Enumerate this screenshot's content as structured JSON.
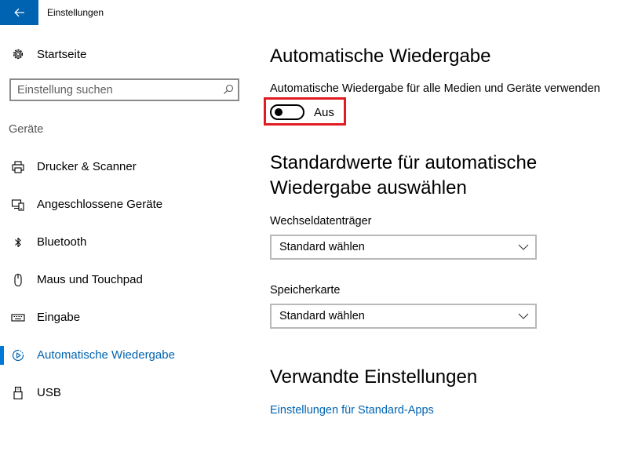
{
  "window": {
    "title": "Einstellungen"
  },
  "sidebar": {
    "home_label": "Startseite",
    "search_placeholder": "Einstellung suchen",
    "section_label": "Geräte",
    "items": [
      {
        "label": "Drucker & Scanner",
        "icon": "printer-icon"
      },
      {
        "label": "Angeschlossene Geräte",
        "icon": "connected-devices-icon"
      },
      {
        "label": "Bluetooth",
        "icon": "bluetooth-icon"
      },
      {
        "label": "Maus und Touchpad",
        "icon": "mouse-icon"
      },
      {
        "label": "Eingabe",
        "icon": "keyboard-icon"
      },
      {
        "label": "Automatische Wiedergabe",
        "icon": "autoplay-icon",
        "active": true
      },
      {
        "label": "USB",
        "icon": "usb-icon"
      }
    ]
  },
  "main": {
    "title": "Automatische Wiedergabe",
    "toggle_description": "Automatische Wiedergabe für alle Medien und Geräte verwenden",
    "toggle_state_label": "Aus",
    "toggle_on": false,
    "defaults_title_line1": "Standardwerte für automatische",
    "defaults_title_line2": "Wiedergabe auswählen",
    "removable_label": "Wechseldatenträger",
    "removable_value": "Standard wählen",
    "memory_card_label": "Speicherkarte",
    "memory_card_value": "Standard wählen",
    "related_title": "Verwandte Einstellungen",
    "related_link": "Einstellungen für Standard-Apps"
  },
  "colors": {
    "accent": "#0063b1",
    "highlight": "#e11b22"
  }
}
